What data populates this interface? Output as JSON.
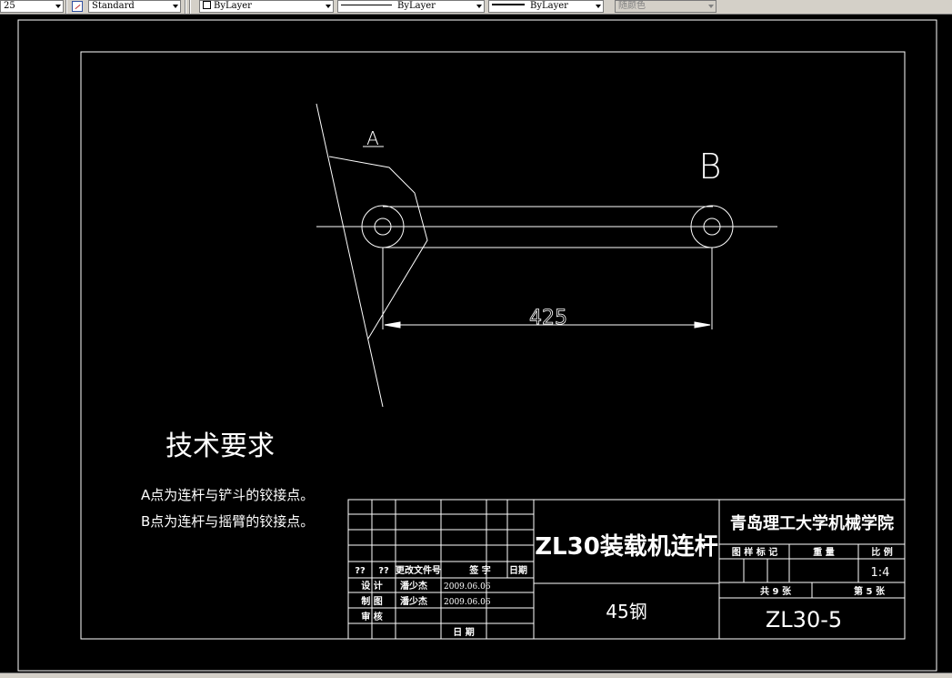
{
  "toolbar": {
    "layer_value": "25",
    "text_style": "Standard",
    "color_control": "ByLayer",
    "linetype_control": "ByLayer",
    "lineweight_control": "ByLayer",
    "plot_style": "随颜色"
  },
  "drawing": {
    "label_a": "A",
    "label_b": "B",
    "dimension": "425",
    "tech_title": "技术要求",
    "note_1": "A点为连杆与铲斗的铰接点。",
    "note_2": "B点为连杆与摇臂的铰接点。"
  },
  "title_block": {
    "part_name": "ZL30装载机连杆",
    "material": "45钢",
    "school": "青岛理工大学机械学院",
    "drawing_number": "ZL30-5",
    "h_q1": "??",
    "h_q2": "??",
    "h_doc": "更改文件号",
    "h_sign": "签 字",
    "h_date": "日期",
    "design_label": "设 计",
    "designer": "潘少杰",
    "design_date": "2009.06.06",
    "draft_label": "制 图",
    "drafter": "潘少杰",
    "draft_date": "2009.06.06",
    "review_label": "审 核",
    "date_label": "日 期",
    "stage_mark": "图 样 标 记",
    "weight": "重 量",
    "scale_label": "比 例",
    "scale_value": "1:4",
    "sheets_total": "共 9 张",
    "sheet_no": "第 5 张"
  }
}
